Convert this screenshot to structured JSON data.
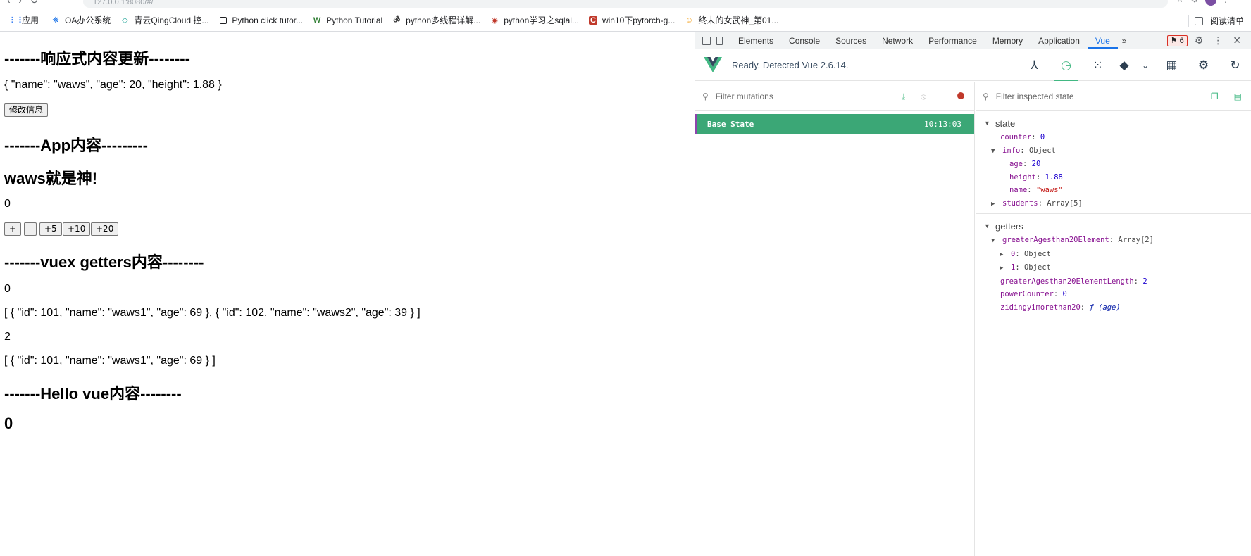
{
  "browser": {
    "url": "127.0.0.1:8080/#/"
  },
  "bookmarks": [
    {
      "label": "应用",
      "icon": "apps-grid-icon",
      "color": "#4285f4"
    },
    {
      "label": "OA办公系统",
      "icon": "oa-icon",
      "color": "#1a73e8"
    },
    {
      "label": "青云QingCloud 控...",
      "icon": "qingcloud-icon",
      "color": "#26a69a"
    },
    {
      "label": "Python click tutor...",
      "icon": "page-icon",
      "color": "#202124"
    },
    {
      "label": "Python Tutorial",
      "icon": "w3-icon",
      "color": "#2e7d32"
    },
    {
      "label": "python多线程详解...",
      "icon": "site-icon",
      "color": "#333333"
    },
    {
      "label": "python学习之sqlal...",
      "icon": "site-icon",
      "color": "#c0392b"
    },
    {
      "label": "win10下pytorch-g...",
      "icon": "csdn-icon",
      "color": "#c0392b"
    },
    {
      "label": "终末的女武神_第01...",
      "icon": "site-icon",
      "color": "#f39c12"
    }
  ],
  "reading_list": "阅读清单",
  "page": {
    "h_reactive": "-------响应式内容更新--------",
    "info_json": "{ \"name\": \"waws\", \"age\": 20, \"height\": 1.88 }",
    "modify_button": "修改信息",
    "h_app": "-------App内容---------",
    "h_god": "waws就是神!",
    "counter": "0",
    "buttons": [
      "+",
      "-",
      "+5",
      "+10",
      "+20"
    ],
    "h_getters": "-------vuex getters内容--------",
    "getter_power": "0",
    "getter_list": "[ { \"id\": 101, \"name\": \"waws1\", \"age\": 69 }, { \"id\": 102, \"name\": \"waws2\", \"age\": 39 } ]",
    "getter_length": "2",
    "getter_list2": "[ { \"id\": 101, \"name\": \"waws1\", \"age\": 69 } ]",
    "h_hello": "-------Hello vue内容--------",
    "hello_counter": "0"
  },
  "devtools": {
    "tabs": [
      "Elements",
      "Console",
      "Sources",
      "Network",
      "Performance",
      "Memory",
      "Application",
      "Vue"
    ],
    "active_tab": "Vue",
    "issues_count": "6",
    "vue_status": "Ready. Detected Vue 2.6.14.",
    "filter_mutations": "Filter mutations",
    "filter_state": "Filter inspected state",
    "base_state": "Base State",
    "base_time": "10:13:03",
    "state_label": "state",
    "getters_label": "getters",
    "state": {
      "counter_key": "counter",
      "counter_val": "0",
      "info_key": "info",
      "info_type": "Object",
      "age_key": "age",
      "age_val": "20",
      "height_key": "height",
      "height_val": "1.88",
      "name_key": "name",
      "name_val": "\"waws\"",
      "students_key": "students",
      "students_type": "Array[5]"
    },
    "getters": {
      "g1_key": "greaterAgesthan20Element",
      "g1_type": "Array[2]",
      "item0": "0",
      "item1": "1",
      "obj": "Object",
      "g2_key": "greaterAgesthan20ElementLength",
      "g2_val": "2",
      "g3_key": "powerCounter",
      "g3_val": "0",
      "g4_key": "zidingyimorethan20",
      "g4_val": "ƒ (age)"
    }
  }
}
